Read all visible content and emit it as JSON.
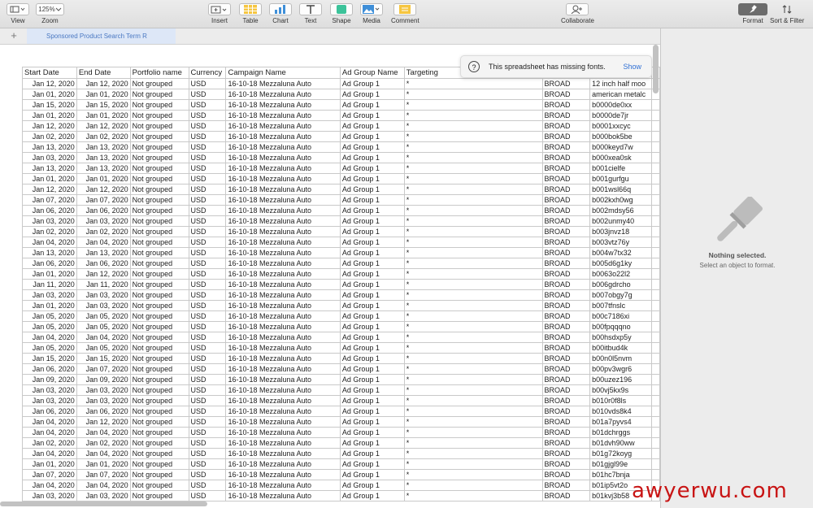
{
  "toolbar": {
    "view": "View",
    "zoom_value": "125%",
    "zoom": "Zoom",
    "insert": "Insert",
    "table": "Table",
    "chart": "Chart",
    "text": "Text",
    "shape": "Shape",
    "media": "Media",
    "comment": "Comment",
    "collaborate": "Collaborate",
    "format": "Format",
    "sort_filter": "Sort & Filter"
  },
  "sheet_tab": "Sponsored Product Search Term R",
  "table": {
    "headers": [
      "Start Date",
      "End Date",
      "Portfolio name",
      "Currency",
      "Campaign Name",
      "Ad Group Name",
      "Targeting",
      "",
      "",
      ""
    ],
    "portfolio": "Not grouped",
    "currency": "USD",
    "campaign": "16-10-18 Mezzaluna Auto",
    "ad_group": "Ad Group 1",
    "targeting": "*",
    "match": "BROAD",
    "rows": [
      [
        "Jan 12, 2020",
        "Jan 12, 2020",
        "12 inch half moo"
      ],
      [
        "Jan 01, 2020",
        "Jan 01, 2020",
        "american metalc"
      ],
      [
        "Jan 15, 2020",
        "Jan 15, 2020",
        "b0000de0xx"
      ],
      [
        "Jan 01, 2020",
        "Jan 01, 2020",
        "b0000de7jr"
      ],
      [
        "Jan 12, 2020",
        "Jan 12, 2020",
        "b0001xxcyc"
      ],
      [
        "Jan 02, 2020",
        "Jan 02, 2020",
        "b000bok5be"
      ],
      [
        "Jan 13, 2020",
        "Jan 13, 2020",
        "b000keyd7w"
      ],
      [
        "Jan 03, 2020",
        "Jan 13, 2020",
        "b000xea0sk"
      ],
      [
        "Jan 13, 2020",
        "Jan 13, 2020",
        "b001cielfe"
      ],
      [
        "Jan 01, 2020",
        "Jan 01, 2020",
        "b001gurfgu"
      ],
      [
        "Jan 12, 2020",
        "Jan 12, 2020",
        "b001wsl66q"
      ],
      [
        "Jan 07, 2020",
        "Jan 07, 2020",
        "b002kxh0wg"
      ],
      [
        "Jan 06, 2020",
        "Jan 06, 2020",
        "b002mdsy56"
      ],
      [
        "Jan 03, 2020",
        "Jan 03, 2020",
        "b002unmy40"
      ],
      [
        "Jan 02, 2020",
        "Jan 02, 2020",
        "b003jnvz18"
      ],
      [
        "Jan 04, 2020",
        "Jan 04, 2020",
        "b003vtz76y"
      ],
      [
        "Jan 13, 2020",
        "Jan 13, 2020",
        "b004w7tx32"
      ],
      [
        "Jan 06, 2020",
        "Jan 06, 2020",
        "b005d6g1ky"
      ],
      [
        "Jan 01, 2020",
        "Jan 12, 2020",
        "b0063o22l2"
      ],
      [
        "Jan 11, 2020",
        "Jan 11, 2020",
        "b006gdrcho"
      ],
      [
        "Jan 03, 2020",
        "Jan 03, 2020",
        "b007obgy7g"
      ],
      [
        "Jan 01, 2020",
        "Jan 03, 2020",
        "b007tfnslc"
      ],
      [
        "Jan 05, 2020",
        "Jan 05, 2020",
        "b00c7186xi"
      ],
      [
        "Jan 05, 2020",
        "Jan 05, 2020",
        "b00fpqqqno"
      ],
      [
        "Jan 04, 2020",
        "Jan 04, 2020",
        "b00hsdxp5y"
      ],
      [
        "Jan 05, 2020",
        "Jan 05, 2020",
        "b00itbud4k"
      ],
      [
        "Jan 15, 2020",
        "Jan 15, 2020",
        "b00n0l5nvm"
      ],
      [
        "Jan 06, 2020",
        "Jan 07, 2020",
        "b00pv3wgr6"
      ],
      [
        "Jan 09, 2020",
        "Jan 09, 2020",
        "b00uzez196"
      ],
      [
        "Jan 03, 2020",
        "Jan 03, 2020",
        "b00vj5kx9s"
      ],
      [
        "Jan 03, 2020",
        "Jan 03, 2020",
        "b010r0f8ls"
      ],
      [
        "Jan 06, 2020",
        "Jan 06, 2020",
        "b010vds8k4"
      ],
      [
        "Jan 04, 2020",
        "Jan 12, 2020",
        "b01a7pyvs4"
      ],
      [
        "Jan 04, 2020",
        "Jan 04, 2020",
        "b01dchrggs"
      ],
      [
        "Jan 02, 2020",
        "Jan 02, 2020",
        "b01dvh90ww"
      ],
      [
        "Jan 04, 2020",
        "Jan 04, 2020",
        "b01g72koyg"
      ],
      [
        "Jan 01, 2020",
        "Jan 01, 2020",
        "b01gjgl99e"
      ],
      [
        "Jan 07, 2020",
        "Jan 07, 2020",
        "b01hc7bnja"
      ],
      [
        "Jan 04, 2020",
        "Jan 04, 2020",
        "b01ip5vt2o"
      ],
      [
        "Jan 03, 2020",
        "Jan 03, 2020",
        "b01kvj3b58"
      ]
    ]
  },
  "notification": {
    "icon": "?",
    "message": "This spreadsheet has missing fonts.",
    "show": "Show"
  },
  "format_panel": {
    "title": "Nothing selected.",
    "subtitle": "Select an object to format."
  },
  "watermark": "awyerwu.com"
}
